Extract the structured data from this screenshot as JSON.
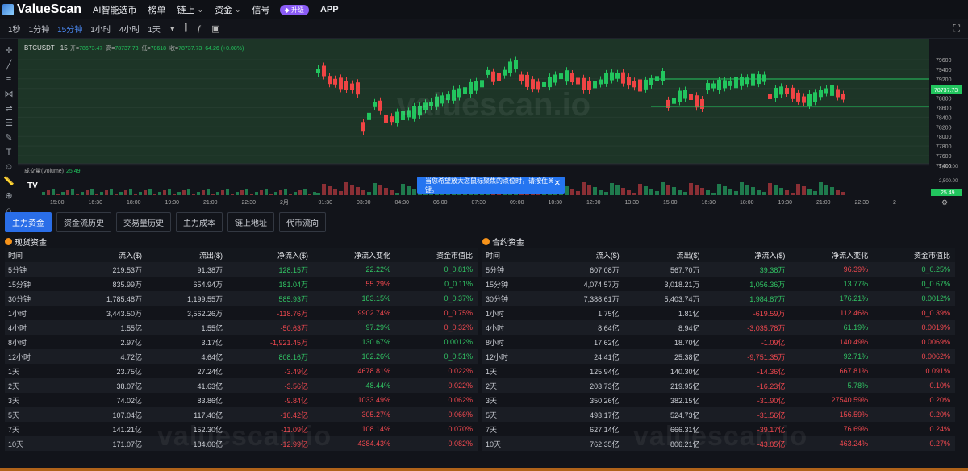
{
  "nav": {
    "logo": "ValueScan",
    "items": [
      {
        "label": "AI智能选币",
        "dropdown": false
      },
      {
        "label": "榜单",
        "dropdown": false
      },
      {
        "label": "链上",
        "dropdown": true
      },
      {
        "label": "资金",
        "dropdown": true
      },
      {
        "label": "信号",
        "dropdown": false
      }
    ],
    "upgrade": "升级",
    "app": "APP"
  },
  "toolbar": {
    "timeframes": [
      "1秒",
      "1分钟",
      "15分钟",
      "1小时",
      "4小时",
      "1天"
    ],
    "active_timeframe": "15分钟"
  },
  "chart_data": {
    "type": "candlestick",
    "title": "BTCUSDT · 15",
    "ohlc_legend": {
      "open_label": "开=",
      "open": "78673.47",
      "high_label": "高=",
      "high": "78737.73",
      "low_label": "低=",
      "low": "78618",
      "close_label": "收=",
      "close": "78737.73",
      "change": "64.26 (+0.08%)"
    },
    "y_ticks": [
      "79600",
      "79400",
      "79200",
      "79000",
      "78800",
      "78600",
      "78400",
      "78200",
      "78000",
      "77800",
      "77600",
      "77400"
    ],
    "last_price": "78737.73",
    "x_ticks": [
      "15:00",
      "16:30",
      "18:00",
      "19:30",
      "21:00",
      "22:30",
      "2月",
      "01:30",
      "03:00",
      "04:30",
      "06:00",
      "07:30",
      "09:00",
      "10:30",
      "12:00",
      "13:30",
      "15:00",
      "16:30",
      "18:00",
      "19:30",
      "21:00",
      "22:30",
      "2"
    ],
    "volume_label": "成交量(Volume)",
    "volume_value": "25.49",
    "volume_ticks": [
      "5,000.00",
      "2,500.00"
    ],
    "colors": {
      "up": "#22c55e",
      "down": "#ef4444",
      "bg": "#1f3a2a"
    }
  },
  "tooltip": {
    "text": "当您希望放大您鼠标聚焦的点位时，请按住⌘ 键。"
  },
  "tabs": [
    "主力资金",
    "资金流历史",
    "交易量历史",
    "主力成本",
    "链上地址",
    "代币流向"
  ],
  "spot": {
    "title": "现货资金",
    "headers": [
      "时间",
      "流入($)",
      "流出($)",
      "净流入($)",
      "净流入变化",
      "资金市值比"
    ],
    "rows": [
      [
        "5分钟",
        "219.53万",
        "91.38万",
        "128.15万",
        "22.22%",
        "0_0.81%"
      ],
      [
        "15分钟",
        "835.99万",
        "654.94万",
        "181.04万",
        "55.29%",
        "0_0.11%"
      ],
      [
        "30分钟",
        "1,785.48万",
        "1,199.55万",
        "585.93万",
        "183.15%",
        "0_0.37%"
      ],
      [
        "1小时",
        "3,443.50万",
        "3,562.26万",
        "-118.76万",
        "9902.74%",
        "0_0.75%"
      ],
      [
        "4小时",
        "1.55亿",
        "1.55亿",
        "-50.63万",
        "97.29%",
        "0_0.32%"
      ],
      [
        "8小时",
        "2.97亿",
        "3.17亿",
        "-1,921.45万",
        "130.67%",
        "0.0012%"
      ],
      [
        "12小时",
        "4.72亿",
        "4.64亿",
        "808.16万",
        "102.26%",
        "0_0.51%"
      ],
      [
        "1天",
        "23.75亿",
        "27.24亿",
        "-3.49亿",
        "4678.81%",
        "0.022%"
      ],
      [
        "2天",
        "38.07亿",
        "41.63亿",
        "-3.56亿",
        "48.44%",
        "0.022%"
      ],
      [
        "3天",
        "74.02亿",
        "83.86亿",
        "-9.84亿",
        "1033.49%",
        "0.062%"
      ],
      [
        "5天",
        "107.04亿",
        "117.46亿",
        "-10.42亿",
        "305.27%",
        "0.066%"
      ],
      [
        "7天",
        "141.21亿",
        "152.30亿",
        "-11.09亿",
        "108.14%",
        "0.070%"
      ],
      [
        "10天",
        "171.07亿",
        "184.06亿",
        "-12.99亿",
        "4384.43%",
        "0.082%"
      ]
    ],
    "row_colors": [
      [
        "pos",
        "pos",
        "pos"
      ],
      [
        "pos",
        "neg",
        "pos"
      ],
      [
        "pos",
        "pos",
        "pos"
      ],
      [
        "neg",
        "neg",
        "neg"
      ],
      [
        "neg",
        "pos",
        "neg"
      ],
      [
        "neg",
        "pos",
        "pos"
      ],
      [
        "pos",
        "pos",
        "pos"
      ],
      [
        "neg",
        "neg",
        "neg"
      ],
      [
        "neg",
        "pos",
        "neg"
      ],
      [
        "neg",
        "neg",
        "neg"
      ],
      [
        "neg",
        "neg",
        "neg"
      ],
      [
        "neg",
        "neg",
        "neg"
      ],
      [
        "neg",
        "neg",
        "neg"
      ]
    ]
  },
  "futures": {
    "title": "合约资金",
    "headers": [
      "时间",
      "流入($)",
      "流出($)",
      "净流入($)",
      "净流入变化",
      "资金市值比"
    ],
    "rows": [
      [
        "5分钟",
        "607.08万",
        "567.70万",
        "39.38万",
        "96.39%",
        "0_0.25%"
      ],
      [
        "15分钟",
        "4,074.57万",
        "3,018.21万",
        "1,056.36万",
        "13.77%",
        "0_0.67%"
      ],
      [
        "30分钟",
        "7,388.61万",
        "5,403.74万",
        "1,984.87万",
        "176.21%",
        "0.0012%"
      ],
      [
        "1小时",
        "1.75亿",
        "1.81亿",
        "-619.59万",
        "112.46%",
        "0_0.39%"
      ],
      [
        "4小时",
        "8.64亿",
        "8.94亿",
        "-3,035.78万",
        "61.19%",
        "0.0019%"
      ],
      [
        "8小时",
        "17.62亿",
        "18.70亿",
        "-1.09亿",
        "140.49%",
        "0.0069%"
      ],
      [
        "12小时",
        "24.41亿",
        "25.38亿",
        "-9,751.35万",
        "92.71%",
        "0.0062%"
      ],
      [
        "1天",
        "125.94亿",
        "140.30亿",
        "-14.36亿",
        "667.81%",
        "0.091%"
      ],
      [
        "2天",
        "203.73亿",
        "219.95亿",
        "-16.23亿",
        "5.78%",
        "0.10%"
      ],
      [
        "3天",
        "350.26亿",
        "382.15亿",
        "-31.90亿",
        "27540.59%",
        "0.20%"
      ],
      [
        "5天",
        "493.17亿",
        "524.73亿",
        "-31.56亿",
        "156.59%",
        "0.20%"
      ],
      [
        "7天",
        "627.14亿",
        "666.31亿",
        "-39.17亿",
        "76.69%",
        "0.24%"
      ],
      [
        "10天",
        "762.35亿",
        "806.21亿",
        "-43.85亿",
        "463.24%",
        "0.27%"
      ]
    ],
    "row_colors": [
      [
        "pos",
        "neg",
        "pos"
      ],
      [
        "pos",
        "pos",
        "pos"
      ],
      [
        "pos",
        "pos",
        "pos"
      ],
      [
        "neg",
        "neg",
        "neg"
      ],
      [
        "neg",
        "pos",
        "neg"
      ],
      [
        "neg",
        "neg",
        "neg"
      ],
      [
        "neg",
        "pos",
        "neg"
      ],
      [
        "neg",
        "neg",
        "neg"
      ],
      [
        "neg",
        "pos",
        "neg"
      ],
      [
        "neg",
        "neg",
        "neg"
      ],
      [
        "neg",
        "neg",
        "neg"
      ],
      [
        "neg",
        "neg",
        "neg"
      ],
      [
        "neg",
        "neg",
        "neg"
      ]
    ]
  },
  "watermark": "valuescan.io"
}
